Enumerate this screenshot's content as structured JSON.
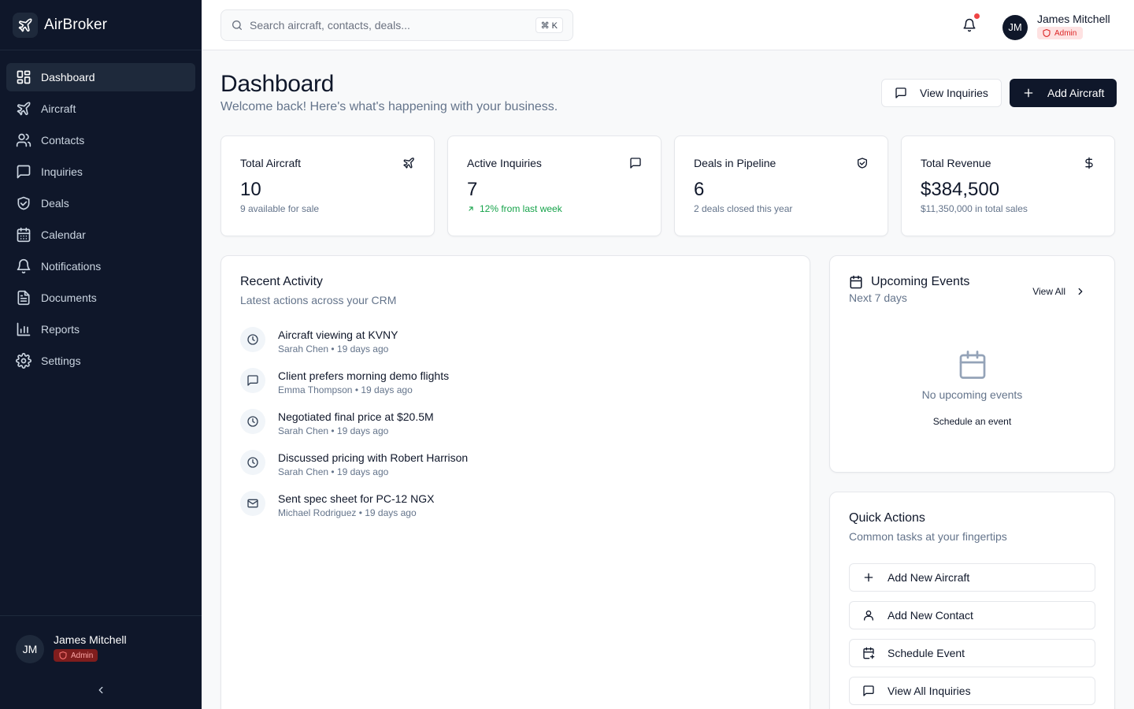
{
  "brand": {
    "name": "AirBroker"
  },
  "sidebar": {
    "items": [
      {
        "label": "Dashboard",
        "icon": "dashboard-icon"
      },
      {
        "label": "Aircraft",
        "icon": "plane-icon"
      },
      {
        "label": "Contacts",
        "icon": "users-icon"
      },
      {
        "label": "Inquiries",
        "icon": "message-icon"
      },
      {
        "label": "Deals",
        "icon": "handshake-icon"
      },
      {
        "label": "Calendar",
        "icon": "calendar-icon"
      },
      {
        "label": "Notifications",
        "icon": "bell-icon"
      },
      {
        "label": "Documents",
        "icon": "document-icon"
      },
      {
        "label": "Reports",
        "icon": "bar-chart-icon"
      },
      {
        "label": "Settings",
        "icon": "gear-icon"
      }
    ],
    "user": {
      "initials": "JM",
      "name": "James Mitchell",
      "role": "Admin"
    }
  },
  "header": {
    "search_placeholder": "Search aircraft, contacts, deals...",
    "shortcut": "⌘ K",
    "user": {
      "initials": "JM",
      "name": "James Mitchell",
      "role": "Admin"
    }
  },
  "page": {
    "title": "Dashboard",
    "subtitle": "Welcome back! Here's what's happening with your business.",
    "view_inquiries_label": "View Inquiries",
    "add_aircraft_label": "Add Aircraft"
  },
  "stats": [
    {
      "title": "Total Aircraft",
      "value": "10",
      "note": "9 available for sale",
      "icon": "plane-icon"
    },
    {
      "title": "Active Inquiries",
      "value": "7",
      "note": "12% from last week",
      "icon": "message-icon"
    },
    {
      "title": "Deals in Pipeline",
      "value": "6",
      "note": "2 deals closed this year",
      "icon": "handshake-icon"
    },
    {
      "title": "Total Revenue",
      "value": "$384,500",
      "note": "$11,350,000 in total sales",
      "icon": "dollar-icon"
    }
  ],
  "activity": {
    "title": "Recent Activity",
    "subtitle": "Latest actions across your CRM",
    "items": [
      {
        "title": "Aircraft viewing at KVNY",
        "meta": "Sarah Chen • 19 days ago",
        "icon": "clock-icon"
      },
      {
        "title": "Client prefers morning demo flights",
        "meta": "Emma Thompson • 19 days ago",
        "icon": "message-icon"
      },
      {
        "title": "Negotiated final price at $20.5M",
        "meta": "Sarah Chen • 19 days ago",
        "icon": "clock-icon"
      },
      {
        "title": "Discussed pricing with Robert Harrison",
        "meta": "Sarah Chen • 19 days ago",
        "icon": "clock-icon"
      },
      {
        "title": "Sent spec sheet for PC-12 NGX",
        "meta": "Michael Rodriguez • 19 days ago",
        "icon": "mail-icon"
      }
    ]
  },
  "events": {
    "title": "Upcoming Events",
    "subtitle": "Next 7 days",
    "view_all": "View All",
    "empty_text": "No upcoming events",
    "schedule_label": "Schedule an event"
  },
  "quick_actions": {
    "title": "Quick Actions",
    "subtitle": "Common tasks at your fingertips",
    "items": [
      {
        "label": "Add New Aircraft",
        "icon": "plus-icon"
      },
      {
        "label": "Add New Contact",
        "icon": "user-icon"
      },
      {
        "label": "Schedule Event",
        "icon": "calendar-plus-icon"
      },
      {
        "label": "View All Inquiries",
        "icon": "message-icon"
      }
    ]
  },
  "colors": {
    "sidebar_bg": "#0f172a",
    "accent_dark": "#0f172a",
    "positive": "#16a34a",
    "danger": "#ef4444"
  }
}
